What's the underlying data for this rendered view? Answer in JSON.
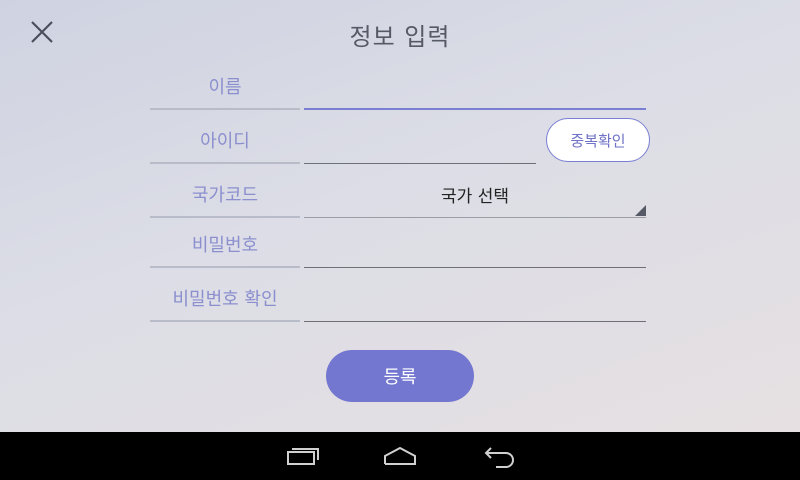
{
  "header": {
    "title": "정보 입력"
  },
  "form": {
    "name_label": "이름",
    "id_label": "아이디",
    "duplicate_check_label": "중복확인",
    "country_label": "국가코드",
    "country_select_value": "국가 선택",
    "password_label": "비밀번호",
    "password_confirm_label": "비밀번호 확인",
    "submit_label": "등록"
  },
  "icons": {
    "close": "close-icon",
    "recent_apps": "recent-apps-icon",
    "home": "home-icon",
    "back": "back-icon"
  },
  "colors": {
    "accent": "#7377d0",
    "label": "#8b8fce",
    "navbar": "#000000"
  }
}
